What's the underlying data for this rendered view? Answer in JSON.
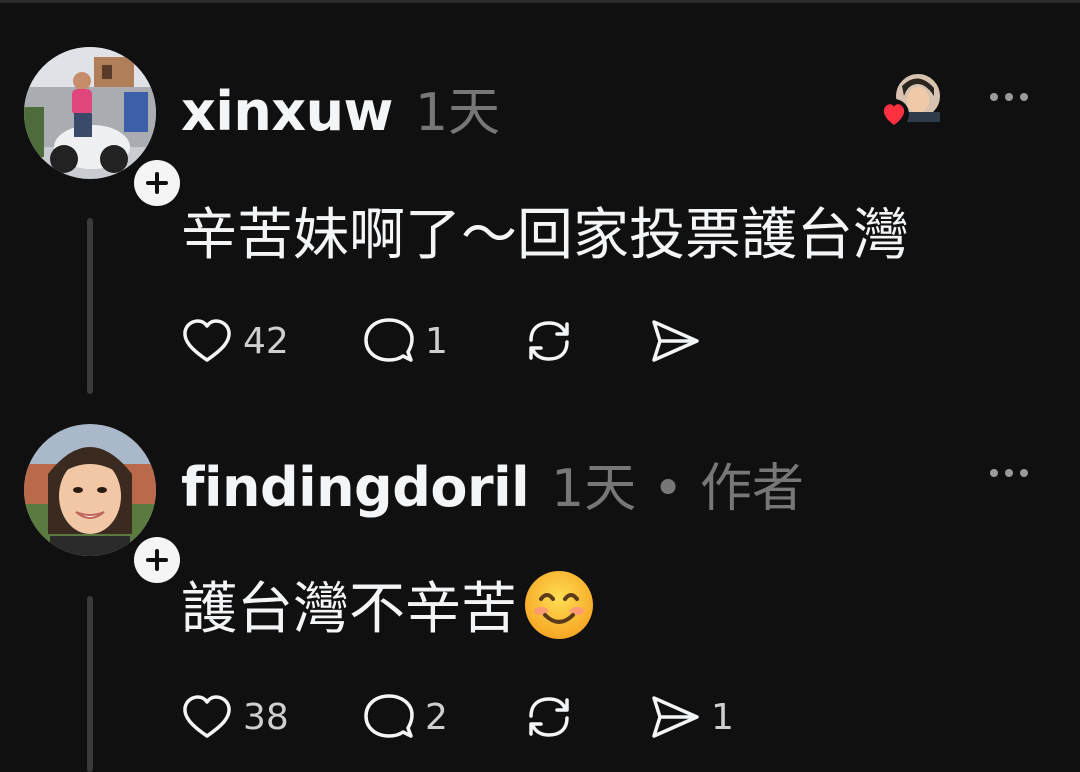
{
  "comments": [
    {
      "username": "xinxuw",
      "time": "1天",
      "text": "辛苦妹啊了～回家投票護台灣",
      "likes": "42",
      "replies": "1",
      "reposts": "",
      "shares": ""
    },
    {
      "username": "findingdoril",
      "time": "1天 • 作者",
      "text": "護台灣不辛苦",
      "emoji": "😊",
      "likes": "38",
      "replies": "2",
      "reposts": "",
      "shares": "1"
    }
  ],
  "icons": {
    "like": "heart-icon",
    "reply": "comment-bubble-icon",
    "repost": "repost-icon",
    "share": "send-icon",
    "more": "more-horizontal-icon",
    "follow": "plus-icon",
    "author_like": "heart-filled-icon"
  },
  "colors": {
    "background": "#101010",
    "text": "#f3f5f7",
    "secondary": "#777777",
    "heart": "#ff3040"
  }
}
